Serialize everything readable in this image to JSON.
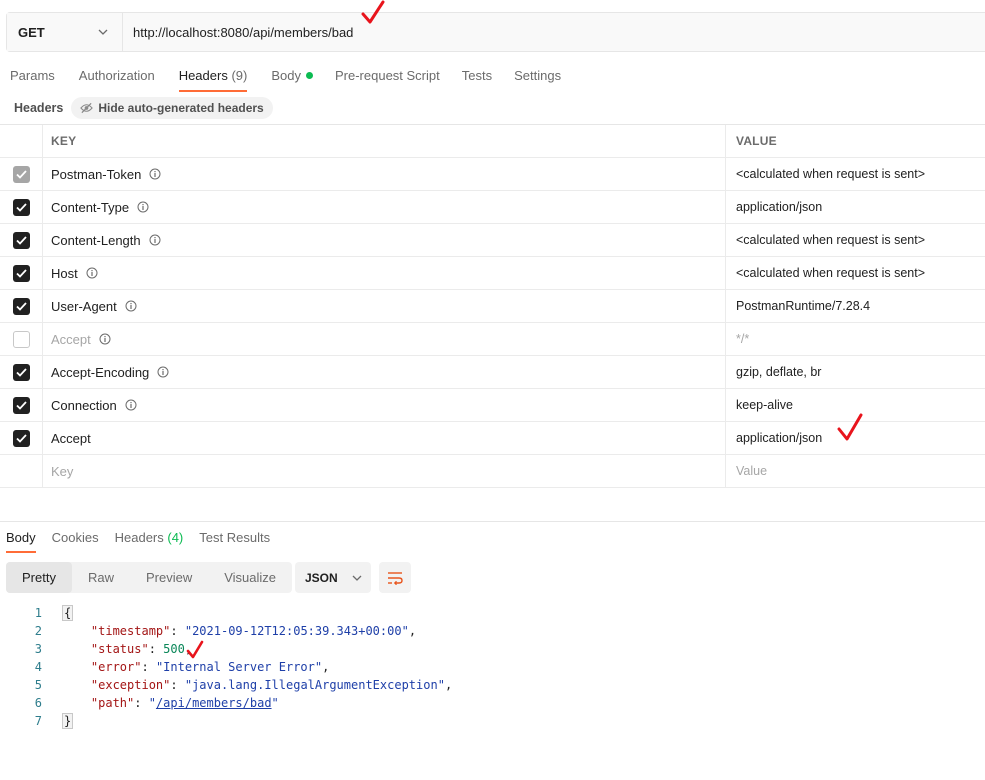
{
  "request": {
    "method": "GET",
    "url": "http://localhost:8080/api/members/bad"
  },
  "request_tabs": [
    {
      "label": "Params"
    },
    {
      "label": "Authorization"
    },
    {
      "label": "Headers",
      "count": "(9)"
    },
    {
      "label": "Body"
    },
    {
      "label": "Pre-request Script"
    },
    {
      "label": "Tests"
    },
    {
      "label": "Settings"
    }
  ],
  "headers_bar": {
    "title": "Headers",
    "hide_button": "Hide auto-generated headers"
  },
  "table": {
    "key_header": "KEY",
    "value_header": "VALUE",
    "rows": [
      {
        "key": "Postman-Token",
        "value": "<calculated when request is sent>",
        "state": "auto"
      },
      {
        "key": "Content-Type",
        "value": "application/json",
        "state": "checked"
      },
      {
        "key": "Content-Length",
        "value": "<calculated when request is sent>",
        "state": "checked"
      },
      {
        "key": "Host",
        "value": "<calculated when request is sent>",
        "state": "checked"
      },
      {
        "key": "User-Agent",
        "value": "PostmanRuntime/7.28.4",
        "state": "checked"
      },
      {
        "key": "Accept",
        "value": "*/*",
        "state": "unchecked"
      },
      {
        "key": "Accept-Encoding",
        "value": "gzip, deflate, br",
        "state": "checked"
      },
      {
        "key": "Connection",
        "value": "keep-alive",
        "state": "checked"
      },
      {
        "key": "Accept",
        "value": "application/json",
        "state": "checked"
      }
    ],
    "key_placeholder": "Key",
    "value_placeholder": "Value"
  },
  "response_tabs": [
    {
      "label": "Body"
    },
    {
      "label": "Cookies"
    },
    {
      "label": "Headers",
      "count": "(4)"
    },
    {
      "label": "Test Results"
    }
  ],
  "response_view": {
    "modes": [
      "Pretty",
      "Raw",
      "Preview",
      "Visualize"
    ],
    "format": "JSON"
  },
  "response_body": {
    "line_numbers": [
      "1",
      "2",
      "3",
      "4",
      "5",
      "6",
      "7"
    ],
    "open_brace": "{",
    "close_brace": "}",
    "fields": [
      {
        "key": "\"timestamp\"",
        "value": "\"2021-09-12T12:05:39.343+00:00\"",
        "kind": "string"
      },
      {
        "key": "\"status\"",
        "value": "500",
        "kind": "number"
      },
      {
        "key": "\"error\"",
        "value": "\"Internal Server Error\"",
        "kind": "string"
      },
      {
        "key": "\"exception\"",
        "value": "\"java.lang.IllegalArgumentException\"",
        "kind": "string"
      },
      {
        "key": "\"path\"",
        "value": "\"/api/members/bad\"",
        "kind": "link"
      }
    ]
  },
  "colors": {
    "accent": "#ff6c37",
    "success": "#0cbb52",
    "annotation": "#e8141c"
  }
}
